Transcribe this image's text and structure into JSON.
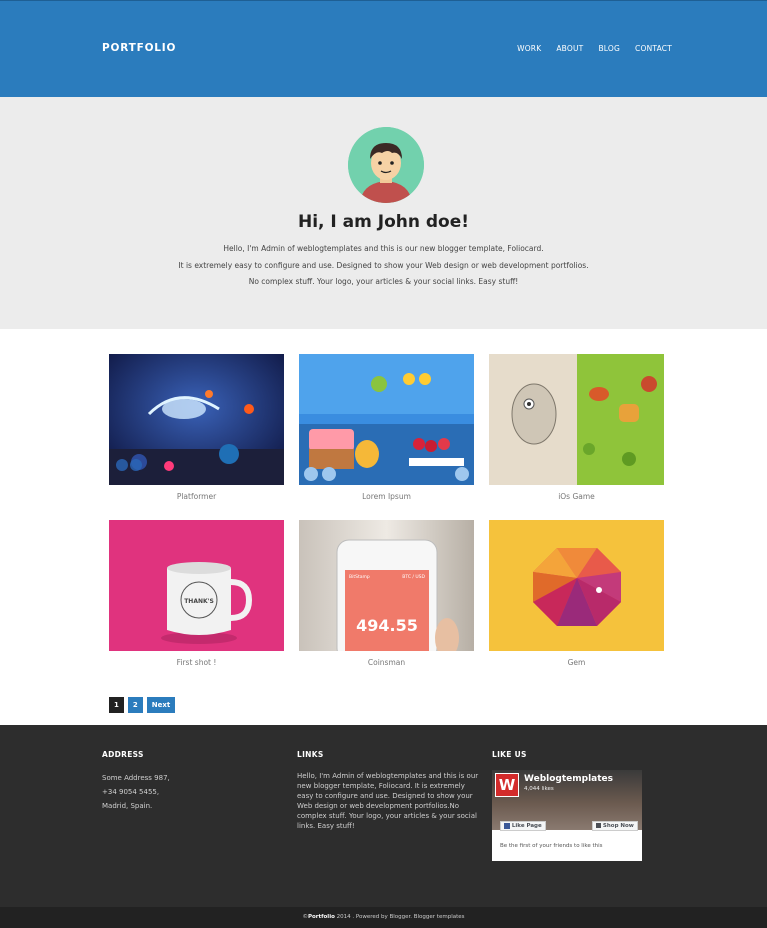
{
  "header": {
    "brand": "PORTFOLIO",
    "nav": [
      "WORK",
      "ABOUT",
      "BLOG",
      "CONTACT"
    ]
  },
  "hero": {
    "title": "Hi, I am John doe!",
    "lines": [
      "Hello, I'm Admin of weblogtemplates and this is our new blogger template, Foliocard.",
      "It is extremely easy to configure and use. Designed to show your Web design or web development portfolios.",
      "No complex stuff. Your logo, your articles & your social links. Easy stuff!"
    ]
  },
  "portfolio": [
    {
      "caption": "Platformer"
    },
    {
      "caption": "Lorem Ipsum"
    },
    {
      "caption": "iOs Game"
    },
    {
      "caption": "First shot !"
    },
    {
      "caption": "Coinsman"
    },
    {
      "caption": "Gem"
    }
  ],
  "thumb_text": {
    "mug": "THANK'S",
    "phone_app": "BitStamp",
    "phone_pair": "BTC / USD",
    "phone_value": "494.55"
  },
  "pagination": {
    "current": "1",
    "page2": "2",
    "next": "Next"
  },
  "footer": {
    "address": {
      "heading": "ADDRESS",
      "lines": [
        "Some Address 987,",
        "+34 9054 5455,",
        "Madrid, Spain."
      ]
    },
    "links": {
      "heading": "LINKS",
      "text": "Hello, I'm Admin of weblogtemplates and this is our new blogger template, Foliocard. It is extremely easy to configure and use. Designed to show your Web design or web development portfolios.No complex stuff. Your logo, your articles & your social links. Easy stuff!"
    },
    "likeus": {
      "heading": "LIKE US",
      "page_name": "Weblogtemplates",
      "likes": "4,044 likes",
      "like_button": "Like Page",
      "shop_button": "Shop Now",
      "footnote": "Be the first of your friends to like this"
    }
  },
  "bottom": {
    "prefix": "©",
    "brand": "Portfolio",
    "rest": " 2014 . Powered by Blogger. Blogger templates"
  }
}
